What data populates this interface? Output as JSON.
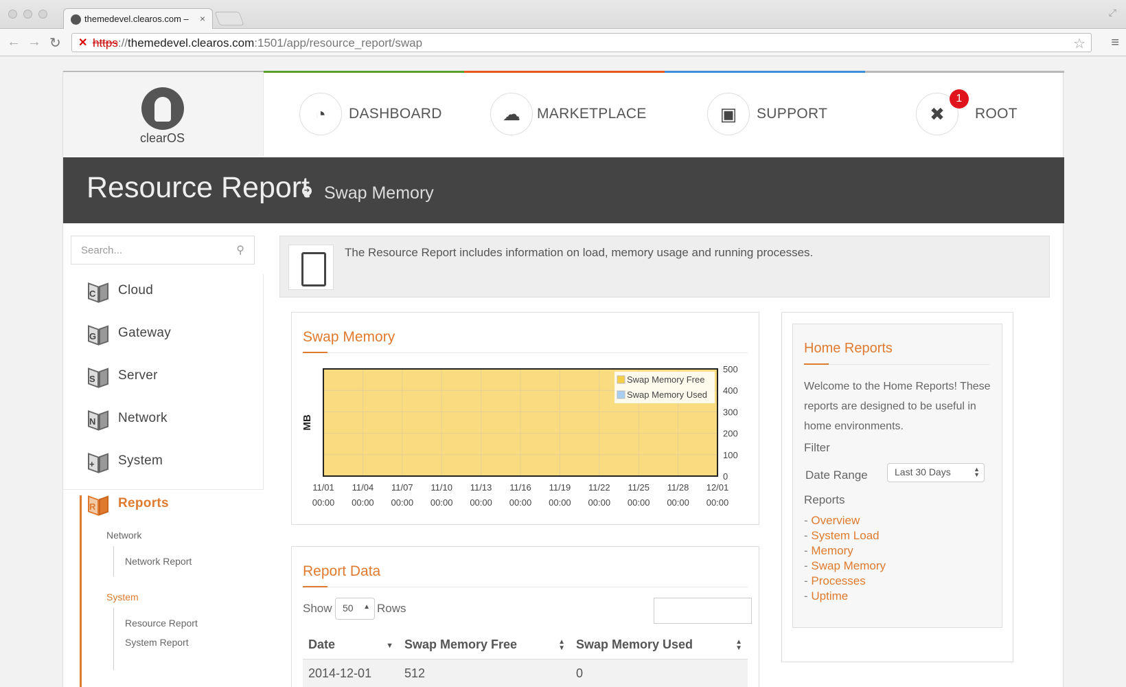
{
  "browser": {
    "tab_title": "themedevel.clearos.com –",
    "tab_close": "×",
    "url_scheme": "https",
    "url_sep": "://",
    "url_host": "themedevel.clearos.com",
    "url_rest": ":1501/app/resource_report/swap",
    "back": "←",
    "forward": "→",
    "reload": "↻",
    "star": "☆",
    "menu": "≡"
  },
  "brand": {
    "logo_text": "clearOS"
  },
  "topnav": [
    {
      "label": "DASHBOARD",
      "icon": "gauge-icon"
    },
    {
      "label": "MARKETPLACE",
      "icon": "cloud-download-icon"
    },
    {
      "label": "SUPPORT",
      "icon": "inbox-icon"
    },
    {
      "label": "ROOT",
      "icon": "tools-icon",
      "badge": "1"
    }
  ],
  "colors": {
    "accent": "#e07a2e",
    "green": "#5aa02c",
    "orange": "#e8571e",
    "blue": "#3c8fd8",
    "gray": "#b9b9b9",
    "badge": "#e0131c"
  },
  "header": {
    "title": "Resource Report",
    "subtitle": "Swap Memory",
    "arrow": "➔"
  },
  "sidebar": {
    "search_placeholder": "Search...",
    "items": [
      {
        "label": "Cloud",
        "letter": "C"
      },
      {
        "label": "Gateway",
        "letter": "G"
      },
      {
        "label": "Server",
        "letter": "S"
      },
      {
        "label": "Network",
        "letter": "N"
      },
      {
        "label": "System",
        "letter": "+"
      },
      {
        "label": "Reports",
        "letter": "R"
      }
    ],
    "reports_groups": {
      "network": {
        "label": "Network",
        "items": [
          "Network Report"
        ]
      },
      "system": {
        "label": "System",
        "items": [
          "Resource Report",
          "System Report"
        ]
      }
    }
  },
  "info": {
    "text": "The Resource Report includes information on load, memory usage and running processes."
  },
  "swap_box": {
    "title": "Swap Memory"
  },
  "chart_data": {
    "type": "area",
    "title": "",
    "ylabel": "MB",
    "xlabel": "",
    "ylim": [
      0,
      500
    ],
    "yticks": [
      "500",
      "400",
      "300",
      "200",
      "100",
      "0"
    ],
    "x_ticks": [
      {
        "date": "11/01",
        "time": "00:00"
      },
      {
        "date": "11/04",
        "time": "00:00"
      },
      {
        "date": "11/07",
        "time": "00:00"
      },
      {
        "date": "11/10",
        "time": "00:00"
      },
      {
        "date": "11/13",
        "time": "00:00"
      },
      {
        "date": "11/16",
        "time": "00:00"
      },
      {
        "date": "11/19",
        "time": "00:00"
      },
      {
        "date": "11/22",
        "time": "00:00"
      },
      {
        "date": "11/25",
        "time": "00:00"
      },
      {
        "date": "11/28",
        "time": "00:00"
      },
      {
        "date": "12/01",
        "time": "00:00"
      }
    ],
    "series": [
      {
        "name": "Swap Memory Free",
        "color": "#f6cf47",
        "values": [
          512,
          512,
          512,
          512,
          512,
          512,
          512,
          512,
          512,
          512,
          512
        ]
      },
      {
        "name": "Swap Memory Used",
        "color": "#a8cff2",
        "values": [
          0,
          0,
          0,
          0,
          0,
          0,
          0,
          0,
          0,
          0,
          0
        ]
      }
    ],
    "grid": true,
    "legend": "top-right"
  },
  "report_data": {
    "title": "Report Data",
    "show_label": "Show",
    "rows_value": "50",
    "rows_label": "Rows",
    "columns": [
      "Date",
      "Swap Memory Free",
      "Swap Memory Used"
    ],
    "rows": [
      [
        "2014-12-01",
        "512",
        "0"
      ]
    ]
  },
  "home_reports": {
    "title": "Home Reports",
    "welcome": "Welcome to the Home Reports! These reports are designed to be useful in home environments.",
    "filter_label": "Filter",
    "date_range_label": "Date Range",
    "date_range_value": "Last 30 Days",
    "reports_label": "Reports",
    "links": [
      "Overview",
      "System Load",
      "Memory",
      "Swap Memory",
      "Processes",
      "Uptime"
    ]
  }
}
